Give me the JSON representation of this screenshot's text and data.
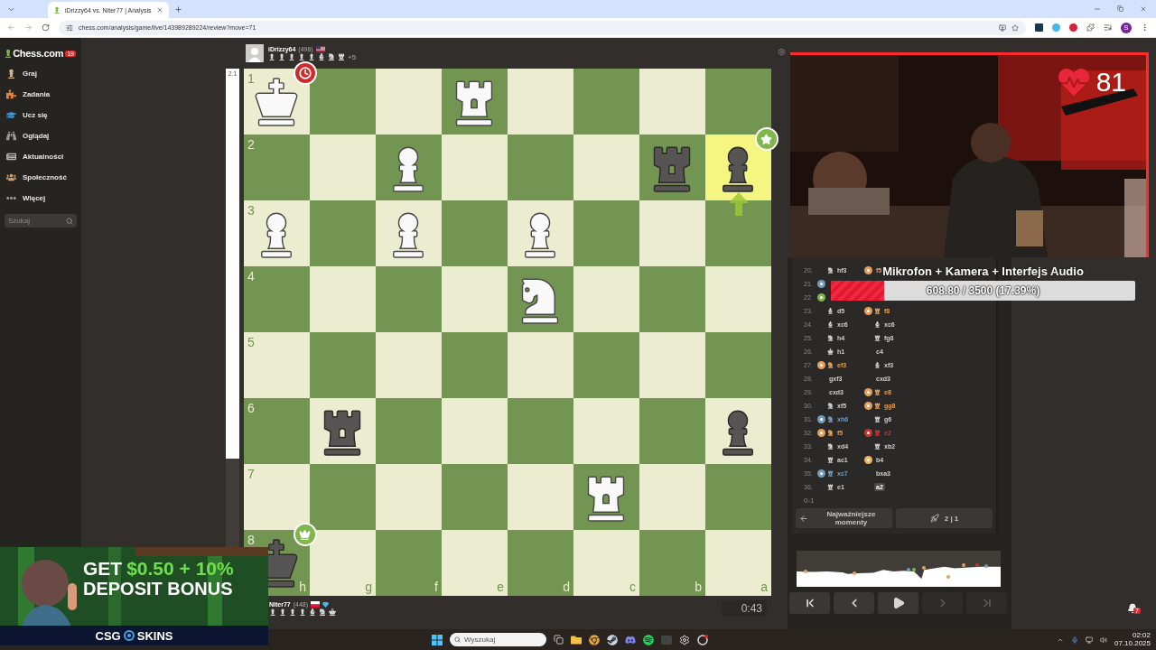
{
  "browser": {
    "tab_title": "iDrizzy64 vs. Niter77 | Analysis",
    "url": "chess.com/analysis/game/live/143989289224/review?move=71",
    "profile_initial": "S"
  },
  "sidebar": {
    "logo": "Chess.com",
    "logo_badge": "19",
    "items": [
      {
        "label": "Graj"
      },
      {
        "label": "Zadania"
      },
      {
        "label": "Ucz się"
      },
      {
        "label": "Oglądaj"
      },
      {
        "label": "Aktualności"
      },
      {
        "label": "Społeczność"
      },
      {
        "label": "Więcej"
      }
    ],
    "search": {
      "placeholder": "Szukaj"
    }
  },
  "eval_bar": {
    "label": "2.1",
    "level": 0.74
  },
  "players": [
    {
      "name": "iDrizzy64",
      "rating": "(496)",
      "captured": [
        {
          "kind": "pawn"
        },
        {
          "kind": "pawn"
        },
        {
          "kind": "pawn"
        },
        {
          "kind": "pawn"
        },
        {
          "kind": "pawn"
        },
        {
          "kind": "bishop"
        },
        {
          "kind": "knight"
        },
        {
          "kind": "rook"
        }
      ],
      "advantage": "+5"
    },
    {
      "name": "Niter77",
      "rating": "(448)",
      "captured": [
        {
          "kind": "pawn"
        },
        {
          "kind": "pawn"
        },
        {
          "kind": "pawn"
        },
        {
          "kind": "pawn"
        },
        {
          "kind": "bishop"
        },
        {
          "kind": "knight"
        },
        {
          "kind": "queen"
        }
      ],
      "clock": "0:43"
    }
  ],
  "board": {
    "files": [
      "h",
      "g",
      "f",
      "e",
      "d",
      "c",
      "b",
      "a"
    ],
    "rows": [
      {
        "rank": "1",
        "cells": [
          {
            "kind": "king",
            "white": true,
            "highlighted": false,
            "badge": {
              "kind": "timeout"
            }
          },
          {
            "kind": "empty",
            "highlighted": false
          },
          {
            "kind": "empty",
            "highlighted": false
          },
          {
            "kind": "rook",
            "white": true,
            "highlighted": false
          },
          {
            "kind": "empty",
            "highlighted": false
          },
          {
            "kind": "empty",
            "highlighted": false
          },
          {
            "kind": "empty",
            "highlighted": false
          },
          {
            "kind": "empty",
            "highlighted": false
          }
        ]
      },
      {
        "rank": "2",
        "cells": [
          {
            "kind": "empty",
            "highlighted": false
          },
          {
            "kind": "empty",
            "highlighted": false
          },
          {
            "kind": "pawn",
            "white": true,
            "highlighted": false
          },
          {
            "kind": "empty",
            "highlighted": false
          },
          {
            "kind": "empty",
            "highlighted": false
          },
          {
            "kind": "empty",
            "highlighted": false
          },
          {
            "kind": "rook",
            "white": false,
            "highlighted": false
          },
          {
            "kind": "pawn",
            "white": false,
            "highlighted": true,
            "badge": {
              "kind": "best"
            },
            "arrow": {
              "kind": "up"
            }
          }
        ]
      },
      {
        "rank": "3",
        "cells": [
          {
            "kind": "pawn",
            "white": true,
            "highlighted": false
          },
          {
            "kind": "empty",
            "highlighted": false
          },
          {
            "kind": "pawn",
            "white": true,
            "highlighted": false
          },
          {
            "kind": "empty",
            "highlighted": false
          },
          {
            "kind": "pawn",
            "white": true,
            "highlighted": false
          },
          {
            "kind": "empty",
            "highlighted": false
          },
          {
            "kind": "empty",
            "highlighted": false
          },
          {
            "kind": "empty",
            "highlighted": false
          }
        ]
      },
      {
        "rank": "4",
        "cells": [
          {
            "kind": "empty",
            "highlighted": false
          },
          {
            "kind": "empty",
            "highlighted": false
          },
          {
            "kind": "empty",
            "highlighted": false
          },
          {
            "kind": "empty",
            "highlighted": false
          },
          {
            "kind": "knight",
            "white": true,
            "highlighted": false
          },
          {
            "kind": "empty",
            "highlighted": false
          },
          {
            "kind": "empty",
            "highlighted": false
          },
          {
            "kind": "empty",
            "highlighted": false
          }
        ]
      },
      {
        "rank": "5",
        "cells": [
          {
            "kind": "empty",
            "highlighted": false
          },
          {
            "kind": "empty",
            "highlighted": false
          },
          {
            "kind": "empty",
            "highlighted": false
          },
          {
            "kind": "empty",
            "highlighted": false
          },
          {
            "kind": "empty",
            "highlighted": false
          },
          {
            "kind": "empty",
            "highlighted": false
          },
          {
            "kind": "empty",
            "highlighted": false
          },
          {
            "kind": "empty",
            "highlighted": false
          }
        ]
      },
      {
        "rank": "6",
        "cells": [
          {
            "kind": "empty",
            "highlighted": false
          },
          {
            "kind": "rook",
            "white": false,
            "highlighted": false
          },
          {
            "kind": "empty",
            "highlighted": false
          },
          {
            "kind": "empty",
            "highlighted": false
          },
          {
            "kind": "empty",
            "highlighted": false
          },
          {
            "kind": "empty",
            "highlighted": false
          },
          {
            "kind": "empty",
            "highlighted": false
          },
          {
            "kind": "pawn",
            "white": false,
            "highlighted": false
          }
        ]
      },
      {
        "rank": "7",
        "cells": [
          {
            "kind": "empty",
            "highlighted": false
          },
          {
            "kind": "empty",
            "highlighted": false
          },
          {
            "kind": "empty",
            "highlighted": false
          },
          {
            "kind": "empty",
            "highlighted": false
          },
          {
            "kind": "empty",
            "highlighted": false
          },
          {
            "kind": "rook",
            "white": true,
            "highlighted": false
          },
          {
            "kind": "empty",
            "highlighted": false
          },
          {
            "kind": "empty",
            "highlighted": false
          }
        ]
      },
      {
        "rank": "8",
        "cells": [
          {
            "kind": "king",
            "white": false,
            "highlighted": false,
            "badge": {
              "kind": "winner"
            }
          },
          {
            "kind": "empty",
            "highlighted": false
          },
          {
            "kind": "empty",
            "highlighted": false
          },
          {
            "kind": "empty",
            "highlighted": false
          },
          {
            "kind": "empty",
            "highlighted": false
          },
          {
            "kind": "empty",
            "highlighted": false
          },
          {
            "kind": "empty",
            "highlighted": false
          },
          {
            "kind": "empty",
            "highlighted": false
          }
        ]
      }
    ]
  },
  "webcam": {
    "kind": "picture",
    "heart_rate": "81"
  },
  "goal": {
    "title": "Mikrofon + Kamera + Interfejs Audio",
    "reading": "608.80 / 3500 (17.39%)",
    "level": 0.1739
  },
  "moves": [
    {
      "number": "20.",
      "white": {
        "san": "hf3",
        "kind": "knight",
        "selected": false
      },
      "black": {
        "san": "f5",
        "kind": "pawn",
        "annotation": {
          "kind": "mistake"
        },
        "selected": false
      }
    },
    {
      "number": "21.",
      "white": {
        "annotation": {
          "kind": "great"
        }
      }
    },
    {
      "number": "22.",
      "white": {
        "annotation": {
          "kind": "best"
        }
      }
    },
    {
      "number": "23.",
      "white": {
        "san": "d5",
        "kind": "bishop",
        "selected": false
      },
      "black": {
        "san": "f8",
        "kind": "rook",
        "annotation": {
          "kind": "mistake"
        },
        "selected": false
      }
    },
    {
      "number": "24.",
      "white": {
        "san": "xc6",
        "kind": "bishop",
        "selected": false
      },
      "black": {
        "san": "xc6",
        "kind": "bishop",
        "selected": false
      }
    },
    {
      "number": "25.",
      "white": {
        "san": "h4",
        "kind": "knight",
        "selected": false
      },
      "black": {
        "san": "fg8",
        "kind": "rook",
        "selected": false
      }
    },
    {
      "number": "26.",
      "white": {
        "san": "h1",
        "kind": "king",
        "selected": false
      },
      "black": {
        "san": "c4",
        "kind": "pawn",
        "selected": false
      }
    },
    {
      "number": "27.",
      "white": {
        "san": "ef3",
        "kind": "knight",
        "annotation": {
          "kind": "mistake"
        },
        "selected": false
      },
      "black": {
        "san": "xf3",
        "kind": "bishop",
        "selected": false
      }
    },
    {
      "number": "28.",
      "white": {
        "san": "gxf3",
        "kind": "pawn",
        "selected": false
      },
      "black": {
        "san": "cxd3",
        "kind": "pawn",
        "selected": false
      }
    },
    {
      "number": "29.",
      "white": {
        "san": "cxd3",
        "kind": "pawn",
        "selected": false
      },
      "black": {
        "san": "e8",
        "kind": "rook",
        "annotation": {
          "kind": "mistake"
        },
        "selected": false
      }
    },
    {
      "number": "30.",
      "white": {
        "san": "xf5",
        "kind": "knight",
        "selected": false
      },
      "black": {
        "san": "gg8",
        "kind": "rook",
        "annotation": {
          "kind": "mistake"
        },
        "selected": false
      }
    },
    {
      "number": "31.",
      "white": {
        "san": "xh6",
        "kind": "knight",
        "annotation": {
          "kind": "great"
        },
        "selected": false
      },
      "black": {
        "san": "g6",
        "kind": "rook",
        "selected": false
      }
    },
    {
      "number": "32.",
      "white": {
        "san": "f5",
        "kind": "knight",
        "annotation": {
          "kind": "mistake"
        },
        "selected": false
      },
      "black": {
        "san": "e2",
        "kind": "rook",
        "annotation": {
          "kind": "blunder"
        },
        "selected": false
      }
    },
    {
      "number": "33.",
      "white": {
        "san": "xd4",
        "kind": "knight",
        "selected": false
      },
      "black": {
        "san": "xb2",
        "kind": "rook",
        "selected": false
      }
    },
    {
      "number": "34.",
      "white": {
        "san": "ac1",
        "kind": "rook",
        "selected": false
      },
      "black": {
        "san": "b4",
        "kind": "pawn",
        "annotation": {
          "kind": "inaccuracy"
        },
        "selected": false
      }
    },
    {
      "number": "35.",
      "white": {
        "san": "xc7",
        "kind": "rook",
        "annotation": {
          "kind": "great"
        },
        "selected": false
      },
      "black": {
        "san": "bxa3",
        "kind": "pawn",
        "selected": false
      }
    },
    {
      "number": "36.",
      "white": {
        "san": "e1",
        "kind": "rook",
        "selected": false
      },
      "black": {
        "san": "a2",
        "kind": "pawn",
        "selected": true
      }
    }
  ],
  "result": "0-1",
  "move_buttons": [
    {
      "label": "Najważniejsze momenty",
      "kind": "back"
    },
    {
      "label": "2 | 1",
      "kind": "rocket"
    }
  ],
  "navigation": [
    {
      "kind": "first",
      "disabled": false
    },
    {
      "kind": "previous",
      "disabled": false
    },
    {
      "kind": "play",
      "disabled": false
    },
    {
      "kind": "next",
      "disabled": true
    },
    {
      "kind": "last",
      "disabled": true
    }
  ],
  "notifications": {
    "count": "7"
  },
  "ad": {
    "kind": "picture",
    "line1_start": "GET",
    "line1_end": "$0.50 + 10%",
    "line2": "DEPOSIT BONUS",
    "brand_start": "CSG",
    "brand_end": "SKINS"
  },
  "taskbar": {
    "search_placeholder": "Wyszukaj",
    "time": "02:02",
    "date": "07.10.2025"
  }
}
